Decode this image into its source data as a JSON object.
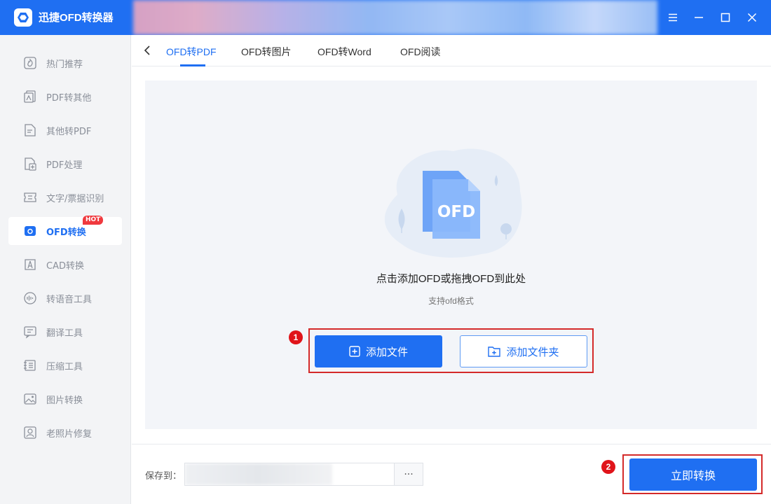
{
  "app": {
    "title": "迅捷OFD转换器"
  },
  "window_controls": {
    "menu_icon": "menu-icon",
    "minimize_icon": "minimize-icon",
    "maximize_icon": "maximize-icon",
    "close_icon": "close-icon"
  },
  "sidebar": {
    "items": [
      {
        "label": "热门推荐",
        "icon": "hot-recommend-icon"
      },
      {
        "label": "PDF转其他",
        "icon": "pdf-convert-icon"
      },
      {
        "label": "其他转PDF",
        "icon": "to-pdf-icon"
      },
      {
        "label": "PDF处理",
        "icon": "pdf-process-icon"
      },
      {
        "label": "文字/票据识别",
        "icon": "ocr-icon"
      },
      {
        "label": "OFD转换",
        "icon": "ofd-icon",
        "active": true,
        "badge": "HOT"
      },
      {
        "label": "CAD转换",
        "icon": "cad-icon"
      },
      {
        "label": "转语音工具",
        "icon": "voice-icon"
      },
      {
        "label": "翻译工具",
        "icon": "translate-icon"
      },
      {
        "label": "压缩工具",
        "icon": "compress-icon"
      },
      {
        "label": "图片转换",
        "icon": "image-icon"
      },
      {
        "label": "老照片修复",
        "icon": "photo-repair-icon"
      }
    ]
  },
  "tabs": [
    {
      "label": "OFD转PDF",
      "active": true
    },
    {
      "label": "OFD转图片"
    },
    {
      "label": "OFD转Word"
    },
    {
      "label": "OFD阅读"
    }
  ],
  "dropzone": {
    "file_icon_text": "OFD",
    "title": "点击添加OFD或拖拽OFD到此处",
    "subtitle": "支持ofd格式",
    "add_file_label": "添加文件",
    "add_folder_label": "添加文件夹",
    "step1": "1"
  },
  "bottom": {
    "save_label": "保存到：",
    "browse_label": "···",
    "convert_label": "立即转换",
    "step2": "2"
  },
  "colors": {
    "accent": "#1f6ff2",
    "annotation_red": "#d42a2a",
    "hot_badge": "#f0393e"
  }
}
